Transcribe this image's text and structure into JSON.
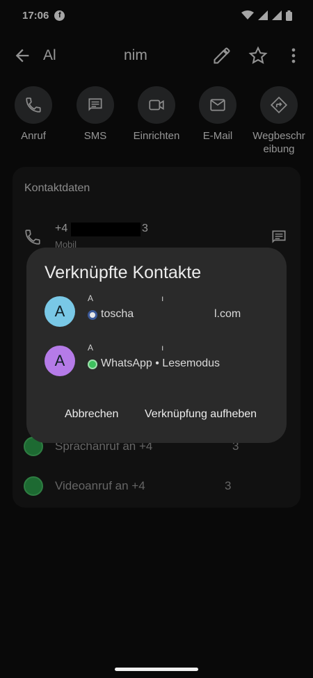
{
  "status": {
    "time": "17:06",
    "fb_glyph": "f"
  },
  "appbar": {
    "title_start": "Al",
    "title_end": "nim"
  },
  "actions": [
    {
      "label": "Anruf"
    },
    {
      "label": "SMS"
    },
    {
      "label": "Einrichten"
    },
    {
      "label": "E-Mail"
    },
    {
      "label": "Wegbeschr eibung"
    }
  ],
  "card": {
    "heading": "Kontaktdaten",
    "phone_start": "+4",
    "phone_end": "3",
    "phone_type": "Mobil",
    "wa_rows": [
      {
        "text": "Sprachanruf an +4",
        "end": "3"
      },
      {
        "text": "Videoanruf an +4",
        "end": "3"
      }
    ]
  },
  "dialog": {
    "title": "Verknüpfte Kontakte",
    "contacts": [
      {
        "initial": "A",
        "name_start": "A",
        "name_end": "ı",
        "source": "toscha",
        "source_end": "l.com",
        "color": "#79c8e6"
      },
      {
        "initial": "A",
        "name_start": "A",
        "name_end": "ı",
        "source": "WhatsApp • Lesemodus",
        "source_end": "",
        "color": "#b57be8"
      }
    ],
    "cancel": "Abbrechen",
    "unlink": "Verknüpfung aufheben"
  }
}
